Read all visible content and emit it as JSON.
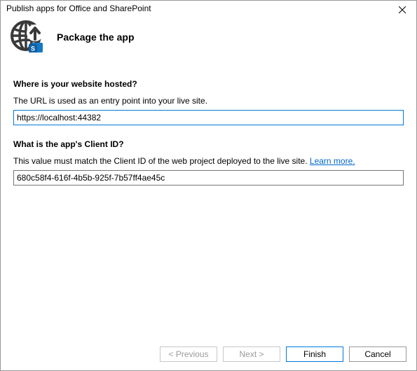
{
  "window": {
    "title": "Publish apps for Office and SharePoint"
  },
  "header": {
    "title": "Package the app"
  },
  "section_url": {
    "label": "Where is your website hosted?",
    "hint": "The URL is used as an entry point into your live site.",
    "value": "https://localhost:44382"
  },
  "section_clientid": {
    "label": "What is the app's Client ID?",
    "hint_prefix": "This value must match the Client ID of the web project deployed to the live site. ",
    "learn_more": "Learn more.",
    "value": "680c58f4-616f-4b5b-925f-7b57ff4ae45c"
  },
  "buttons": {
    "previous": "< Previous",
    "next": "Next >",
    "finish": "Finish",
    "cancel": "Cancel"
  }
}
